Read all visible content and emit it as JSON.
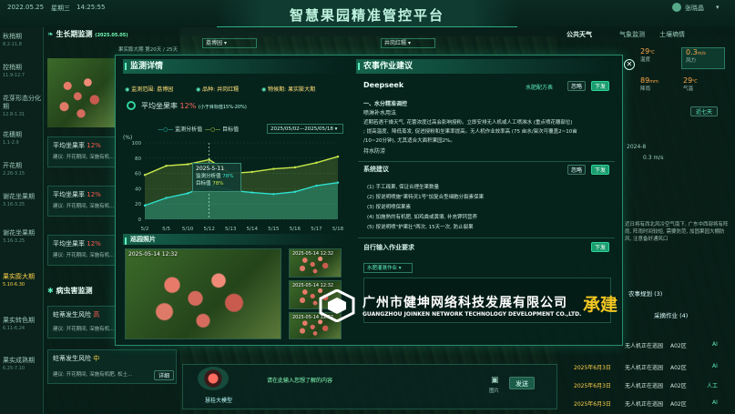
{
  "header": {
    "date": "2022.05.25",
    "weekday": "星期三",
    "time": "14:25:55",
    "title": "智慧果园精准管控平台",
    "user": "张晓晶"
  },
  "growth_stages": [
    {
      "label": "秋梢期",
      "sub": "8.2-11.8"
    },
    {
      "label": "控梢期",
      "sub": "11.9-12.7"
    },
    {
      "label": "花芽形态分化期",
      "sub": "12.8-1.31"
    },
    {
      "label": "花穗期",
      "sub": "1.1-2.9"
    },
    {
      "label": "开花期",
      "sub": "2.26-3.15"
    },
    {
      "label": "谢花坐果期",
      "sub": "3.16-3.25"
    },
    {
      "label": "谢花坐果期",
      "sub": "3.16-3.25"
    },
    {
      "label": "果实膨大期",
      "sub": "5.10-6.30"
    },
    {
      "label": "果实转色期",
      "sub": "6.11-6.24"
    },
    {
      "label": "果实成熟期",
      "sub": "6.25-7.10"
    }
  ],
  "left_panel": {
    "title": "生长期监测",
    "title_sub": "(2025.05.05)",
    "filter_note": "果实膨大期 第20天 / 25天",
    "cards": [
      {
        "title": "平均坐果率",
        "value": "12%",
        "desc": "建议: 开花期间, 深施有机..."
      },
      {
        "title": "平均坐果率",
        "value": "12%",
        "desc": "建议: 开花期间, 深施有机..."
      },
      {
        "title": "平均坐果率",
        "value": "12%",
        "desc": "建议: 开花期间, 深施有机..."
      }
    ],
    "pest_title": "病虫害监测",
    "pest_cards": [
      {
        "title": "蛀蒂发生风险",
        "level": "高",
        "desc": "建议: 开花期间, 深施有机..."
      },
      {
        "title": "蛀蒂发生风险",
        "level": "中",
        "desc": "建议: 开花期间, 深施有机肥, 松土..."
      }
    ],
    "detail_label": "详细"
  },
  "filters": {
    "orchard": "荔博园",
    "variety": "井岗红糯"
  },
  "right_panel": {
    "tabs": [
      "公共天气",
      "气象监测",
      "土壤墒情"
    ],
    "weather": [
      {
        "value": "29",
        "unit": "℃",
        "label": "温度"
      },
      {
        "value": "0.3",
        "unit": "m/s",
        "label": "风力"
      },
      {
        "value": "89",
        "unit": "mm",
        "label": "降雨"
      },
      {
        "value": "29",
        "unit": "℃",
        "label": "气温"
      }
    ],
    "recent_btn": "近七天",
    "month_label": "2024-8",
    "wind_label": "0.3 m/s",
    "alert_text": "近日将有西北风冷空气南下, 广东中西部将有阵雨, 阵雨时间较短, 需要防范, 加固果园大棚防风, 注意备好通风口",
    "tasks_title": "农事作业",
    "task_tab1": "农事规划",
    "task_tab1_count": "(3)",
    "task_tab2": "采摘作业",
    "task_tab2_count": "(4)",
    "task_rows": [
      {
        "date": "2025年6月3日",
        "desc": "无人机正在巡园",
        "zone": "A02区",
        "badge": "AI"
      },
      {
        "date": "2025年6月3日",
        "desc": "无人机正在巡园",
        "zone": "A02区",
        "badge": "AI"
      },
      {
        "date": "2025年6月3日",
        "desc": "无人机正在巡园",
        "zone": "A02区",
        "badge": "人工"
      },
      {
        "date": "2025年6月3日",
        "desc": "无人机正在巡园",
        "zone": "A02区",
        "badge": "AI"
      }
    ]
  },
  "modal": {
    "left_title": "监测详情",
    "scope_label": "监测范围: 荔博园",
    "variety_label": "品种: 井岗红糯",
    "phase_label": "物候期: 果实膨大期",
    "metric_label": "平均坐果率",
    "metric_value": "12%",
    "metric_target": "(小于目标值15%-20%)",
    "legend_a": "监测分析值",
    "legend_b": "目标值",
    "date_range": "2025/05/02—2025/05/18",
    "y_unit": "(%)",
    "tooltip": {
      "date": "2025-5-11",
      "row1_label": "监测分析值",
      "row1_value": "78%",
      "row2_label": "目标值",
      "row2_value": "78%"
    },
    "photos_title": "巡园照片",
    "photo_times": [
      "2025-05-14 12:32",
      "2025-05-14 12:32",
      "2025-05-14 12:32",
      "2025-05-14 12:32"
    ],
    "right_title": "农事作业建议",
    "deepseek_label": "Deepseek",
    "deepseek_tag": "水肥配方表",
    "ignore_btn": "忽略",
    "issue_btn": "下发",
    "advice_h1": "一、水分精准调控",
    "advice_h2": "喷淋补水用法",
    "advice_lines": [
      "近期若遇干燥天气, 花蕾浓度过高会影响授粉。立即安排无人机或人工喷淋水 (重点喷花穗部位)",
      "; 提高温度、降低蒸发, 促进授粉和坐果率提高。无人机作业效率高 (75 亩水/架次可覆盖2~10亩",
      "/10~20分钟), 尤其适合大面积果园2%。"
    ],
    "advice_end": "持水防涝",
    "system_title": "系统建议",
    "system_items": [
      "(1) 手工疏果, 保证合理坐果数量",
      "(2) 按说明喷施\"果特灵1号\"加复合型细胞分裂素保果",
      "(3) 按说明喷保果素",
      "(4) 加施熟的有机肥, 如鸡粪或黄壤, 补充钾钙营养",
      "(5) 按说明喷\"护果壮\"两次, 15天一次, 防止裂果"
    ],
    "manual_title": "自行输入作业要求",
    "manual_select": "水肥灌溉作业"
  },
  "chat": {
    "placeholder": "请在此输入您想了解的内容",
    "send": "发送",
    "image_label": "图片",
    "model_label": "慧桂大模型"
  },
  "banner": {
    "company_cn": "广州市健坤网络科技发展有限公司",
    "company_en": "GUANGZHOU JOINKEN NETWORK TECHNOLOGY DEVELOPMENT CO.,LTD.",
    "build": "承建"
  },
  "chart_data": {
    "type": "area",
    "x": [
      "5/2",
      "5/5",
      "5/10",
      "5/12",
      "5/13",
      "5/14",
      "5/15",
      "5/16",
      "5/17",
      "5/18"
    ],
    "series": [
      {
        "name": "监测分析值",
        "color": "#2fe0d0",
        "values": [
          18,
          28,
          34,
          45,
          38,
          35,
          33,
          36,
          44,
          48
        ]
      },
      {
        "name": "目标值",
        "color": "#c8e84a",
        "values": [
          58,
          70,
          72,
          78,
          60,
          62,
          66,
          68,
          74,
          82
        ]
      }
    ],
    "ylabel": "(%)",
    "ylim": [
      0,
      100
    ],
    "yticks": [
      0,
      20,
      40,
      60,
      80,
      100
    ]
  }
}
